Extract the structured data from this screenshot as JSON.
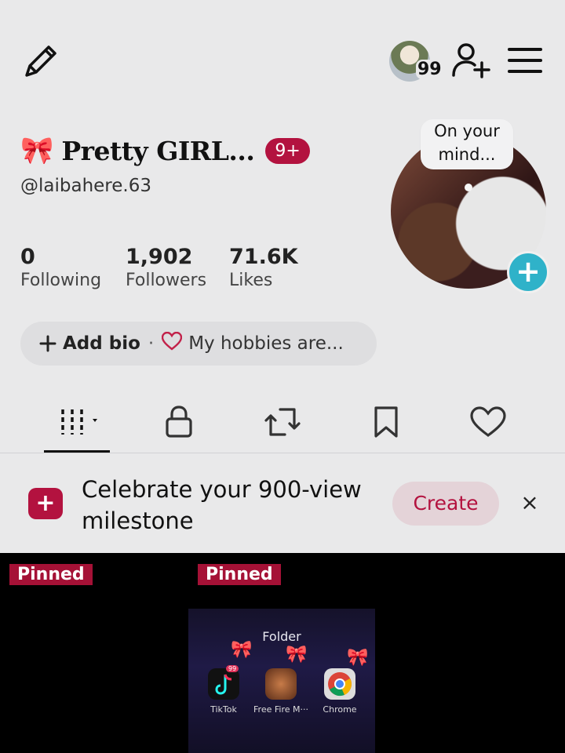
{
  "header": {
    "avatar_count": "99"
  },
  "profile": {
    "display_name": "Pretty GIRL...",
    "bow_emoji": "🎀",
    "notif_badge": "9+",
    "username": "@laibahere.63",
    "bubble_text": "On your mind...",
    "add_symbol": "+"
  },
  "stats": [
    {
      "value": "0",
      "label": "Following"
    },
    {
      "value": "1,902",
      "label": "Followers"
    },
    {
      "value": "71.6K",
      "label": "Likes"
    }
  ],
  "bio": {
    "add_label": "Add bio",
    "separator": "·",
    "hobbies": "My hobbies are..."
  },
  "milestone": {
    "text": "Celebrate your 900-view milestone",
    "create_label": "Create",
    "close_symbol": "×"
  },
  "grid": {
    "pinned_label": "Pinned",
    "folder": {
      "title": "Folder",
      "tiktok_badge": "99",
      "apps": [
        "TikTok",
        "Free Fire M···",
        "Chrome"
      ]
    }
  },
  "colors": {
    "accent": "#b3123f",
    "plus_button": "#2fb2c9",
    "background": "#e9e9ea"
  },
  "icons": [
    "pencil-icon",
    "user-plus-icon",
    "menu-icon",
    "grid-icon",
    "lock-icon",
    "repost-icon",
    "bookmark-icon",
    "heart-icon",
    "close-icon"
  ]
}
